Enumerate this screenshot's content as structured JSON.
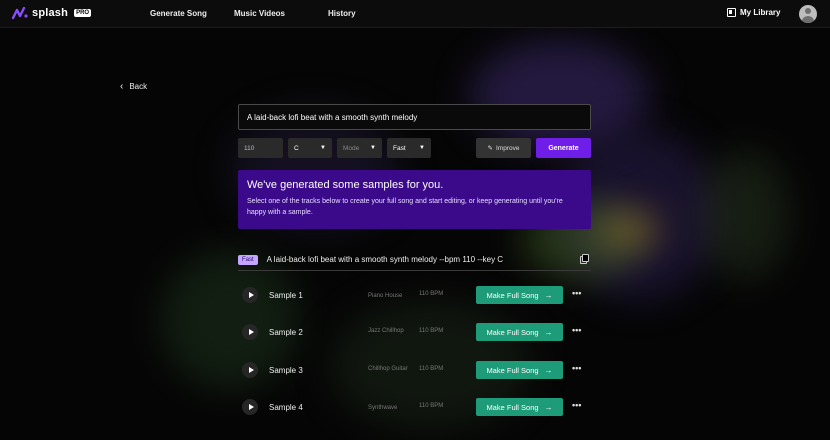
{
  "nav": {
    "brand": "splash",
    "badge": "PRO",
    "items": [
      "Generate Song",
      "Music Videos",
      "History"
    ],
    "library": "My Library"
  },
  "back_label": "Back",
  "prompt_value": "A laid-back lofi beat with a smooth synth melody",
  "controls": {
    "bpm": "110",
    "key": "C",
    "mode": "Mode",
    "speed": "Fast",
    "improve": "Improve",
    "generate": "Generate"
  },
  "banner": {
    "title": "We've generated some samples for you.",
    "text": "Select one of the tracks below to create your full song and start editing, or keep generating until you're happy with a sample."
  },
  "echo": {
    "tag": "Fast",
    "text": "A laid-back lofi beat with a smooth synth melody --bpm 110 --key C"
  },
  "samples": [
    {
      "name": "Sample 1",
      "genre": "Piano House",
      "bpm": "110 BPM",
      "action": "Make Full Song"
    },
    {
      "name": "Sample 2",
      "genre": "Jazz Chillhop",
      "bpm": "110 BPM",
      "action": "Make Full Song"
    },
    {
      "name": "Sample 3",
      "genre": "Chillhop Guitar",
      "bpm": "110 BPM",
      "action": "Make Full Song"
    },
    {
      "name": "Sample 4",
      "genre": "Synthwave",
      "bpm": "110 BPM",
      "action": "Make Full Song"
    }
  ],
  "colors": {
    "accent": "#6f1ee8",
    "banner": "#3a0a8a",
    "action_green": "#1e9b78"
  }
}
